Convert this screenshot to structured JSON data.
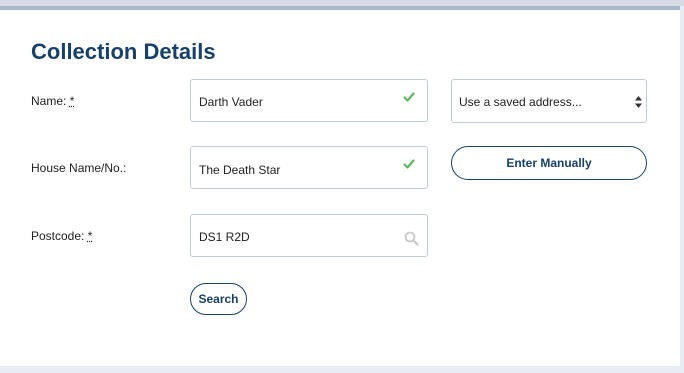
{
  "section": {
    "title": "Collection Details"
  },
  "form": {
    "name": {
      "label": "Name:",
      "required_marker": "*",
      "value": "Darth Vader"
    },
    "house": {
      "label": "House Name/No.:",
      "value": "The Death Star"
    },
    "postcode": {
      "label": "Postcode:",
      "required_marker": "*",
      "value": "DS1 R2D"
    },
    "saved_address": {
      "selected": "Use a saved address..."
    },
    "enter_manually_label": "Enter Manually",
    "search_label": "Search"
  },
  "colors": {
    "brand": "#17416b",
    "valid": "#5cb85c",
    "field_border": "#c3cbd6"
  },
  "icons": {
    "valid": "check-icon",
    "lookup": "magnifier-icon",
    "select": "up-down-arrows-icon"
  }
}
